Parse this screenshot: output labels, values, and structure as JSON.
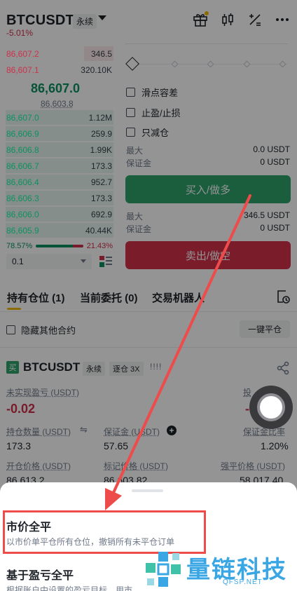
{
  "header": {
    "symbol": "BTCUSDT",
    "contract_type": "永续",
    "change": "-5.01%",
    "icons": [
      "gift-icon",
      "candlestick-icon",
      "calculator-icon",
      "more-icon"
    ]
  },
  "orderbook": {
    "asks": [
      {
        "price": "86,607.2",
        "qty": "346.5"
      },
      {
        "price": "86,607.1",
        "qty": "320.10K"
      }
    ],
    "last_price": "86,607.0",
    "mark_price": "86,603.8",
    "bids": [
      {
        "price": "86,607.0",
        "qty": "1.12M"
      },
      {
        "price": "86,606.9",
        "qty": "259.9"
      },
      {
        "price": "86,606.8",
        "qty": "1.99K"
      },
      {
        "price": "86,606.7",
        "qty": "173.3"
      },
      {
        "price": "86,606.4",
        "qty": "952.7"
      },
      {
        "price": "86,606.3",
        "qty": "173.3"
      },
      {
        "price": "86,606.0",
        "qty": "692.9"
      },
      {
        "price": "86,605.9",
        "qty": "40.44K"
      }
    ],
    "buy_ratio": "78.57%",
    "sell_ratio": "21.43%",
    "buy_ratio_value": 0.7857,
    "depth": "0.1"
  },
  "order_form": {
    "options": [
      "滑点容差",
      "止盈/止损",
      "只减仓"
    ],
    "buy": {
      "max_label": "最大",
      "max_value": "0.0 USDT",
      "margin_label": "保证金",
      "margin_value": "0 USDT",
      "button": "买入/做多"
    },
    "sell": {
      "max_label": "最大",
      "max_value": "346.5 USDT",
      "margin_label": "保证金",
      "margin_value": "0 USDT",
      "button": "卖出/做空"
    }
  },
  "tabs": [
    "持有仓位 (1)",
    "当前委托 (0)",
    "交易机器人"
  ],
  "positions_bar": {
    "hide_others": "隐藏其他合约",
    "close_all": "一键平仓"
  },
  "position": {
    "badge": "买",
    "symbol": "BTCUSDT",
    "type": "永续",
    "margin_mode": "逐仓 3X",
    "bars": "!!!!",
    "unrealized_pnl_label": "未实现盈亏 (USDT)",
    "unrealized_pnl": "-0.02",
    "roi_label": "投",
    "roi_value": "-",
    "size_label": "持仓数量 (USDT)",
    "size_value": "173.3",
    "margin_label": "保证金 (USDT)",
    "margin_value": "57.65",
    "margin_ratio_label": "保证金比率",
    "margin_ratio_value": "1.20%",
    "entry_label": "开仓价格 (USDT)",
    "entry_value": "86,613.2",
    "mark_label": "标记价格 (USDT)",
    "mark_value": "86,603.82",
    "liq_label": "强平价格 (USDT)",
    "liq_value": "58,017.40"
  },
  "sheet": {
    "option1_title": "市价全平",
    "option1_desc": "以市价单平仓所有仓位，撤销所有未平仓订单",
    "option2_title": "基于盈亏全平",
    "option2_desc": "根据账户中设置的盈亏目标，用市"
  },
  "watermark": {
    "text": "量链科技",
    "sub": "QFSP.NET"
  },
  "colors": {
    "green": "#2ea36c",
    "red": "#d5314a",
    "highlight": "#ee4b4b",
    "arrow": "#ee4b4b",
    "accent": "#f0b90b"
  }
}
